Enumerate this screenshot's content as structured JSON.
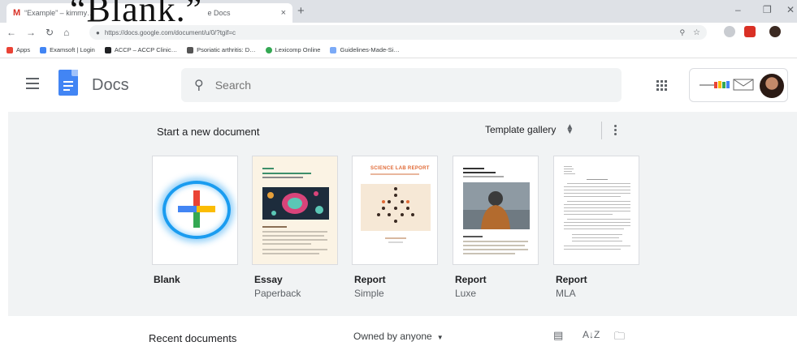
{
  "overlay_caption": "“Blank.”",
  "browser": {
    "tab_title": "“Example” – kimmy…",
    "tab_title_right": "e Docs",
    "tab_close": "×",
    "new_tab": "+",
    "url": "https://docs.google.com/document/u/0/?tgif=c",
    "bookmarks": [
      {
        "label": "Apps",
        "color": "#ea4335"
      },
      {
        "label": "Examsoft | Login",
        "color": "#4285f4"
      },
      {
        "label": "ACCP – ACCP Clinic…",
        "color": "#202124"
      },
      {
        "label": "Psoriatic arthritis: D…",
        "color": "#555555"
      },
      {
        "label": "Lexicomp Online",
        "color": "#34a853"
      },
      {
        "label": "Guidelines-Made-Si…",
        "color": "#7baaf7"
      }
    ]
  },
  "header": {
    "app_name": "Docs",
    "search_placeholder": "Search"
  },
  "templates": {
    "start_label": "Start a new document",
    "gallery_label": "Template gallery",
    "items": [
      {
        "title": "Blank",
        "subtitle": ""
      },
      {
        "title": "Essay",
        "subtitle": "Paperback"
      },
      {
        "title": "Report",
        "subtitle": "Simple"
      },
      {
        "title": "Report",
        "subtitle": "Luxe"
      },
      {
        "title": "Report",
        "subtitle": "MLA"
      }
    ],
    "report_simple_heading": "SCIENCE LAB REPORT"
  },
  "recent": {
    "label": "Recent documents",
    "owner_filter": "Owned by anyone"
  },
  "colors": {
    "docs_blue": "#4285f4",
    "highlight_ring": "#1a9cf0"
  }
}
